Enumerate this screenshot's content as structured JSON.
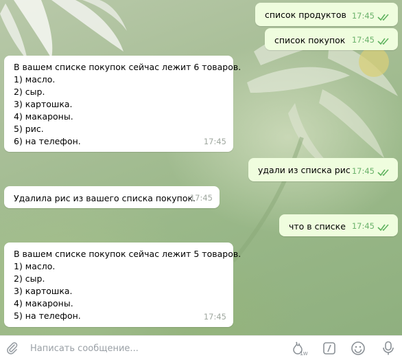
{
  "messages": [
    {
      "direction": "out",
      "text": "список продуктов",
      "time": "17:45"
    },
    {
      "direction": "out",
      "text": "список покупок",
      "time": "17:45"
    },
    {
      "direction": "in",
      "lines": [
        "В вашем списке покупок сейчас лежит 6 товаров.",
        "1) масло.",
        "2) сыр.",
        "3) картошка.",
        "4) макароны.",
        "5) рис.",
        "6) на телефон."
      ],
      "time": "17:45"
    },
    {
      "direction": "out",
      "text": "удали из списка рис",
      "time": "17:45"
    },
    {
      "direction": "in",
      "text": "Удалила рис из вашего списка покупок.",
      "time": "17:45"
    },
    {
      "direction": "out",
      "text": "что в списке",
      "time": "17:45"
    },
    {
      "direction": "in",
      "lines": [
        "В вашем списке покупок сейчас лежит 5 товаров.",
        "1) масло.",
        "2) сыр.",
        "3) картошка.",
        "4) макароны.",
        "5) на телефон."
      ],
      "time": "17:45"
    }
  ],
  "composer": {
    "placeholder": "Написать сообщение...",
    "timer_badge": "1w"
  },
  "icons": {
    "attach": "paperclip-icon",
    "timer": "fire-timer-icon",
    "commands": "slash-commands-icon",
    "emoji": "smiley-icon",
    "voice": "microphone-icon"
  },
  "colors": {
    "incoming_bubble": "#ffffff",
    "outgoing_bubble": "#effdde",
    "outgoing_time": "#6bb26b",
    "read_ticks": "#5fb35f"
  }
}
